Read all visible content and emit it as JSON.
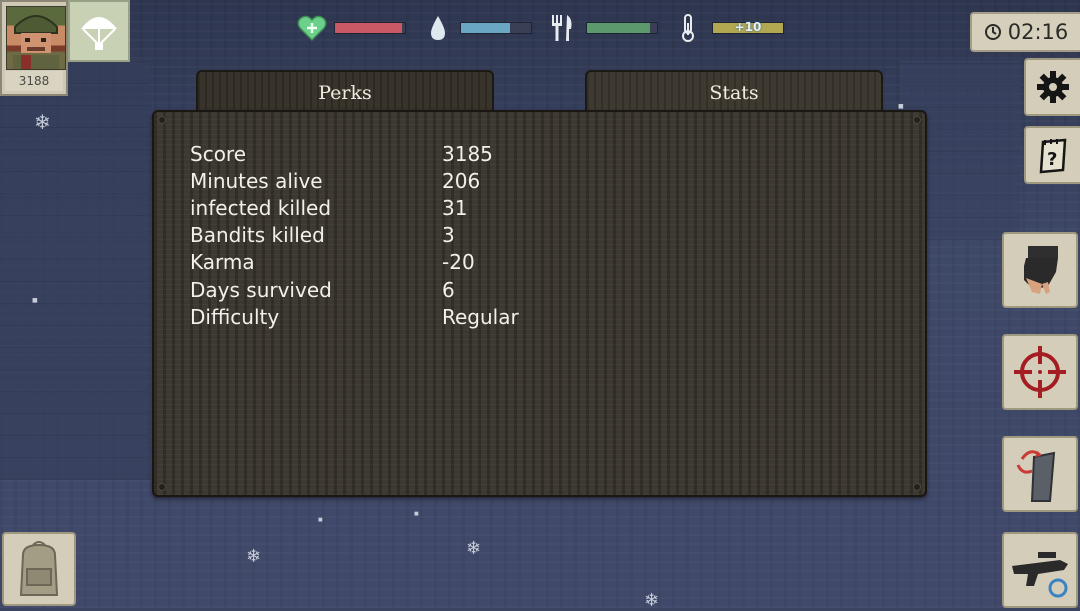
{
  "player": {
    "score_badge": "3188"
  },
  "status_bars": {
    "health": {
      "level": 0.95,
      "color": "#c95a63"
    },
    "water": {
      "level": 0.7,
      "color": "#6aa7c3"
    },
    "food": {
      "level": 0.9,
      "color": "#5c9a6e"
    },
    "temperature": {
      "level": 1.0,
      "color": "#b3a852",
      "label": "+10"
    }
  },
  "timer": {
    "time": "02:16"
  },
  "tabs": [
    {
      "label": "Perks"
    },
    {
      "label": "Stats"
    }
  ],
  "stats": {
    "rows": [
      {
        "label": "Score",
        "value": "3185"
      },
      {
        "label": "Minutes alive",
        "value": "206"
      },
      {
        "label": "infected killed",
        "value": "31"
      },
      {
        "label": "Bandits killed",
        "value": "3"
      },
      {
        "label": "Karma",
        "value": "-20"
      },
      {
        "label": "Days survived",
        "value": "6"
      },
      {
        "label": "Difficulty",
        "value": "Regular"
      }
    ]
  },
  "icons": {
    "health": "heart-icon",
    "water": "water-drop-icon",
    "food": "fork-knife-icon",
    "temperature": "thermometer-icon",
    "settings": "gear-icon",
    "journal": "notebook-icon",
    "interact": "hand-icon",
    "aim": "crosshair-icon",
    "reload": "reload-magazine-icon",
    "weapon": "rifle-icon",
    "inventory": "backpack-icon",
    "airdrop": "parachute-icon"
  }
}
